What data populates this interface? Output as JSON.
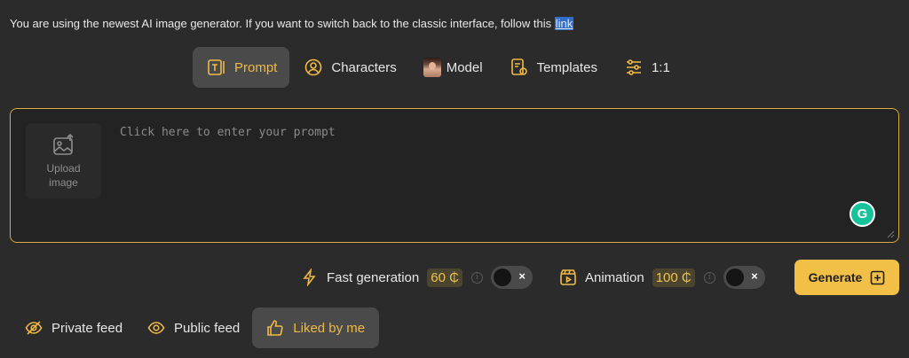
{
  "notice": {
    "text": "You are using the newest AI image generator. If you want to switch back to the classic interface, follow this ",
    "link_label": "link"
  },
  "tabs": [
    {
      "label": "Prompt",
      "icon": "prompt-icon",
      "active": true
    },
    {
      "label": "Characters",
      "icon": "characters-icon",
      "active": false
    },
    {
      "label": "Model",
      "icon": "model-thumbnail",
      "active": false
    },
    {
      "label": "Templates",
      "icon": "templates-icon",
      "active": false
    },
    {
      "label": "1:1",
      "icon": "sliders-icon",
      "active": false
    }
  ],
  "prompt": {
    "placeholder": "Click here to enter your prompt",
    "value": "",
    "upload_label": "Upload image"
  },
  "options": {
    "fast_generation": {
      "label": "Fast generation",
      "price": "60 ₵",
      "enabled": false
    },
    "animation": {
      "label": "Animation",
      "price": "100 ₵",
      "enabled": false
    }
  },
  "generate_label": "Generate",
  "feeds": [
    {
      "label": "Private feed",
      "icon": "eye-slash-icon",
      "active": false
    },
    {
      "label": "Public feed",
      "icon": "eye-icon",
      "active": false
    },
    {
      "label": "Liked by me",
      "icon": "thumbs-up-icon",
      "active": true
    }
  ],
  "colors": {
    "background": "#2b2b2b",
    "accent": "#f0b945",
    "generate_button": "#f3c047",
    "prompt_border": "#d8aa3f",
    "grammarly": "#15c39a"
  }
}
